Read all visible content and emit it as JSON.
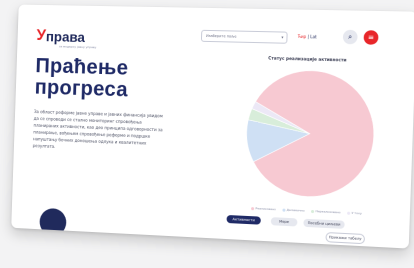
{
  "logo": {
    "mark": "У",
    "word": "права",
    "tagline": "за модерну јавну управу"
  },
  "header": {
    "search_text": "Изаберите поље",
    "lang_active": "Ћир",
    "lang_sep": "|",
    "lang_other": "Lat",
    "search_icon": "search-icon",
    "menu_icon": "menu-icon"
  },
  "hero": {
    "title": "Праћење прогреса",
    "description": "За област реформе јавне управе и јавних финансија увидом да се спроводи се стално мониторинг спровођења планираних активности, као део принципа одговорности за планирање, вођењем спровођење реформе и подршке напуштању бочних доношења одлука и квалитетних резултата."
  },
  "chart_title": "Статус реализације активности",
  "chart_data": {
    "type": "pie",
    "categories": [
      "Реализовано",
      "Делимично",
      "Нереализовано",
      "У току"
    ],
    "values": [
      84,
      11,
      3,
      2
    ],
    "colors": [
      "#f7c9d2",
      "#cfe0f4",
      "#d8edda",
      "#ece8f6"
    ]
  },
  "legend": [
    "Реализовано",
    "Делимично",
    "Нереализовано",
    "У току"
  ],
  "buttons": {
    "a": "Активности",
    "b": "Мере",
    "c": "Посебни циљеви",
    "d": "Прикажи табелу"
  },
  "colors": {
    "accent": "#e8262a",
    "brand": "#1f2a66"
  }
}
